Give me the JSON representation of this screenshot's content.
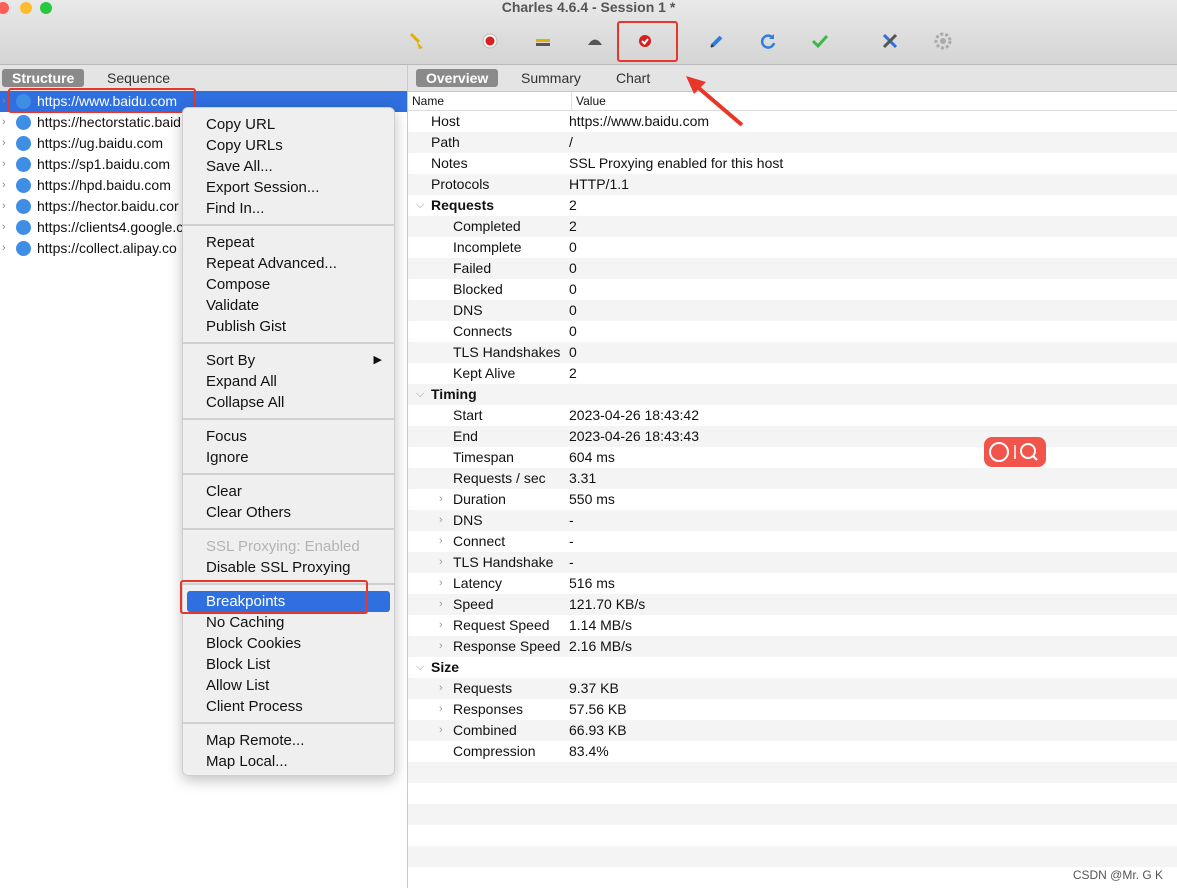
{
  "window": {
    "title": "Charles 4.6.4 - Session 1 *"
  },
  "toolbar": {
    "buttons": [
      {
        "name": "broom-icon",
        "color": "#e0b000"
      },
      {
        "name": "record-icon",
        "color": "#d62020"
      },
      {
        "name": "throttle-icon",
        "color": "#666666"
      },
      {
        "name": "turtle-icon",
        "color": "#555555"
      },
      {
        "name": "breakpoint-icon",
        "color": "#d62020"
      },
      {
        "name": "compose-pen-icon",
        "color": "#2f7de0"
      },
      {
        "name": "repeat-icon",
        "color": "#2f7de0"
      },
      {
        "name": "validate-check-icon",
        "color": "#3cb84a"
      },
      {
        "name": "tools-icon",
        "color": "#2f6fe0"
      },
      {
        "name": "settings-gear-icon",
        "color": "#aaaaaa"
      }
    ]
  },
  "left": {
    "tabs": [
      "Structure",
      "Sequence"
    ],
    "hosts": [
      "https://www.baidu.com",
      "https://hectorstatic.baid",
      "https://ug.baidu.com",
      "https://sp1.baidu.com",
      "https://hpd.baidu.com",
      "https://hector.baidu.cor",
      "https://clients4.google.c",
      "https://collect.alipay.co"
    ]
  },
  "context_menu": {
    "groups": [
      [
        "Copy URL",
        "Copy URLs",
        "Save All...",
        "Export Session...",
        "Find In..."
      ],
      [
        "Repeat",
        "Repeat Advanced...",
        "Compose",
        "Validate",
        "Publish Gist"
      ],
      [
        "Sort By",
        "Expand All",
        "Collapse All"
      ],
      [
        "Focus",
        "Ignore"
      ],
      [
        "Clear",
        "Clear Others"
      ],
      [
        "SSL Proxying: Enabled",
        "Disable SSL Proxying"
      ],
      [
        "Breakpoints",
        "No Caching",
        "Block Cookies",
        "Block List",
        "Allow List",
        "Client Process"
      ],
      [
        "Map Remote...",
        "Map Local..."
      ]
    ],
    "disabled_item": "SSL Proxying: Enabled",
    "highlighted_item": "Breakpoints",
    "submenu_item": "Sort By"
  },
  "right": {
    "tabs": [
      "Overview",
      "Summary",
      "Chart"
    ],
    "columns": [
      "Name",
      "Value"
    ],
    "rows": [
      {
        "k": "Host",
        "v": "https://www.baidu.com",
        "level": 1
      },
      {
        "k": "Path",
        "v": "/",
        "level": 1
      },
      {
        "k": "Notes",
        "v": "SSL Proxying enabled for this host",
        "level": 1
      },
      {
        "k": "Protocols",
        "v": "HTTP/1.1",
        "level": 1
      },
      {
        "k": "Requests",
        "v": "2",
        "level": 0,
        "section": true
      },
      {
        "k": "Completed",
        "v": "2",
        "level": 2
      },
      {
        "k": "Incomplete",
        "v": "0",
        "level": 2
      },
      {
        "k": "Failed",
        "v": "0",
        "level": 2
      },
      {
        "k": "Blocked",
        "v": "0",
        "level": 2
      },
      {
        "k": "DNS",
        "v": "0",
        "level": 2
      },
      {
        "k": "Connects",
        "v": "0",
        "level": 2
      },
      {
        "k": "TLS Handshakes",
        "v": "0",
        "level": 2
      },
      {
        "k": "Kept Alive",
        "v": "2",
        "level": 2
      },
      {
        "k": "Timing",
        "v": "",
        "level": 0,
        "section": true
      },
      {
        "k": "Start",
        "v": "2023-04-26 18:43:42",
        "level": 2
      },
      {
        "k": "End",
        "v": "2023-04-26 18:43:43",
        "level": 2
      },
      {
        "k": "Timespan",
        "v": "604 ms",
        "level": 2
      },
      {
        "k": "Requests / sec",
        "v": "3.31",
        "level": 2
      },
      {
        "k": "Duration",
        "v": "550 ms",
        "level": 2,
        "collapsed": true
      },
      {
        "k": "DNS",
        "v": "-",
        "level": 2,
        "collapsed": true
      },
      {
        "k": "Connect",
        "v": "-",
        "level": 2,
        "collapsed": true
      },
      {
        "k": "TLS Handshake",
        "v": "-",
        "level": 2,
        "collapsed": true
      },
      {
        "k": "Latency",
        "v": "516 ms",
        "level": 2,
        "collapsed": true
      },
      {
        "k": "Speed",
        "v": "121.70 KB/s",
        "level": 2,
        "collapsed": true
      },
      {
        "k": "Request Speed",
        "v": "1.14 MB/s",
        "level": 2,
        "collapsed": true
      },
      {
        "k": "Response Speed",
        "v": "2.16 MB/s",
        "level": 2,
        "collapsed": true
      },
      {
        "k": "Size",
        "v": "",
        "level": 0,
        "section": true
      },
      {
        "k": "Requests",
        "v": "9.37 KB",
        "level": 2,
        "collapsed": true
      },
      {
        "k": "Responses",
        "v": "57.56 KB",
        "level": 2,
        "collapsed": true
      },
      {
        "k": "Combined",
        "v": "66.93 KB",
        "level": 2,
        "collapsed": true
      },
      {
        "k": "Compression",
        "v": "83.4%",
        "level": 2
      }
    ]
  },
  "watermark": "CSDN @Mr. G K",
  "colors": {
    "selection": "#2f6fe0",
    "annotation_red": "#e8362a"
  }
}
